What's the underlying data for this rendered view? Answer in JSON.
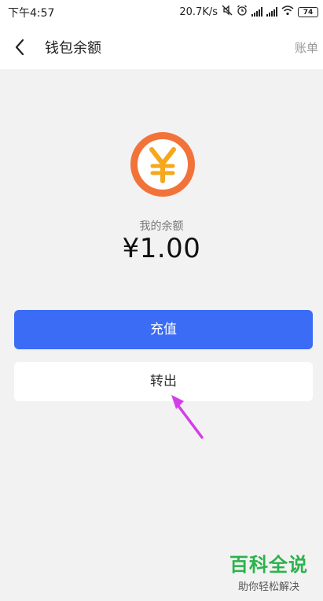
{
  "statusbar": {
    "time": "下午4:57",
    "speed": "20.7K/s",
    "battery": "74"
  },
  "nav": {
    "title": "钱包余额",
    "action": "账单"
  },
  "balance": {
    "label": "我的余额",
    "amount": "¥1.00",
    "coin_symbol": "¥"
  },
  "buttons": {
    "recharge": "充值",
    "withdraw": "转出"
  },
  "colors": {
    "primary": "#3b6cf6",
    "coin": "#f2733a",
    "coin_symbol": "#f5a81c",
    "annotation_arrow": "#d43ee8"
  },
  "watermark": {
    "title": "百科全说",
    "subtitle": "助你轻松解决"
  }
}
